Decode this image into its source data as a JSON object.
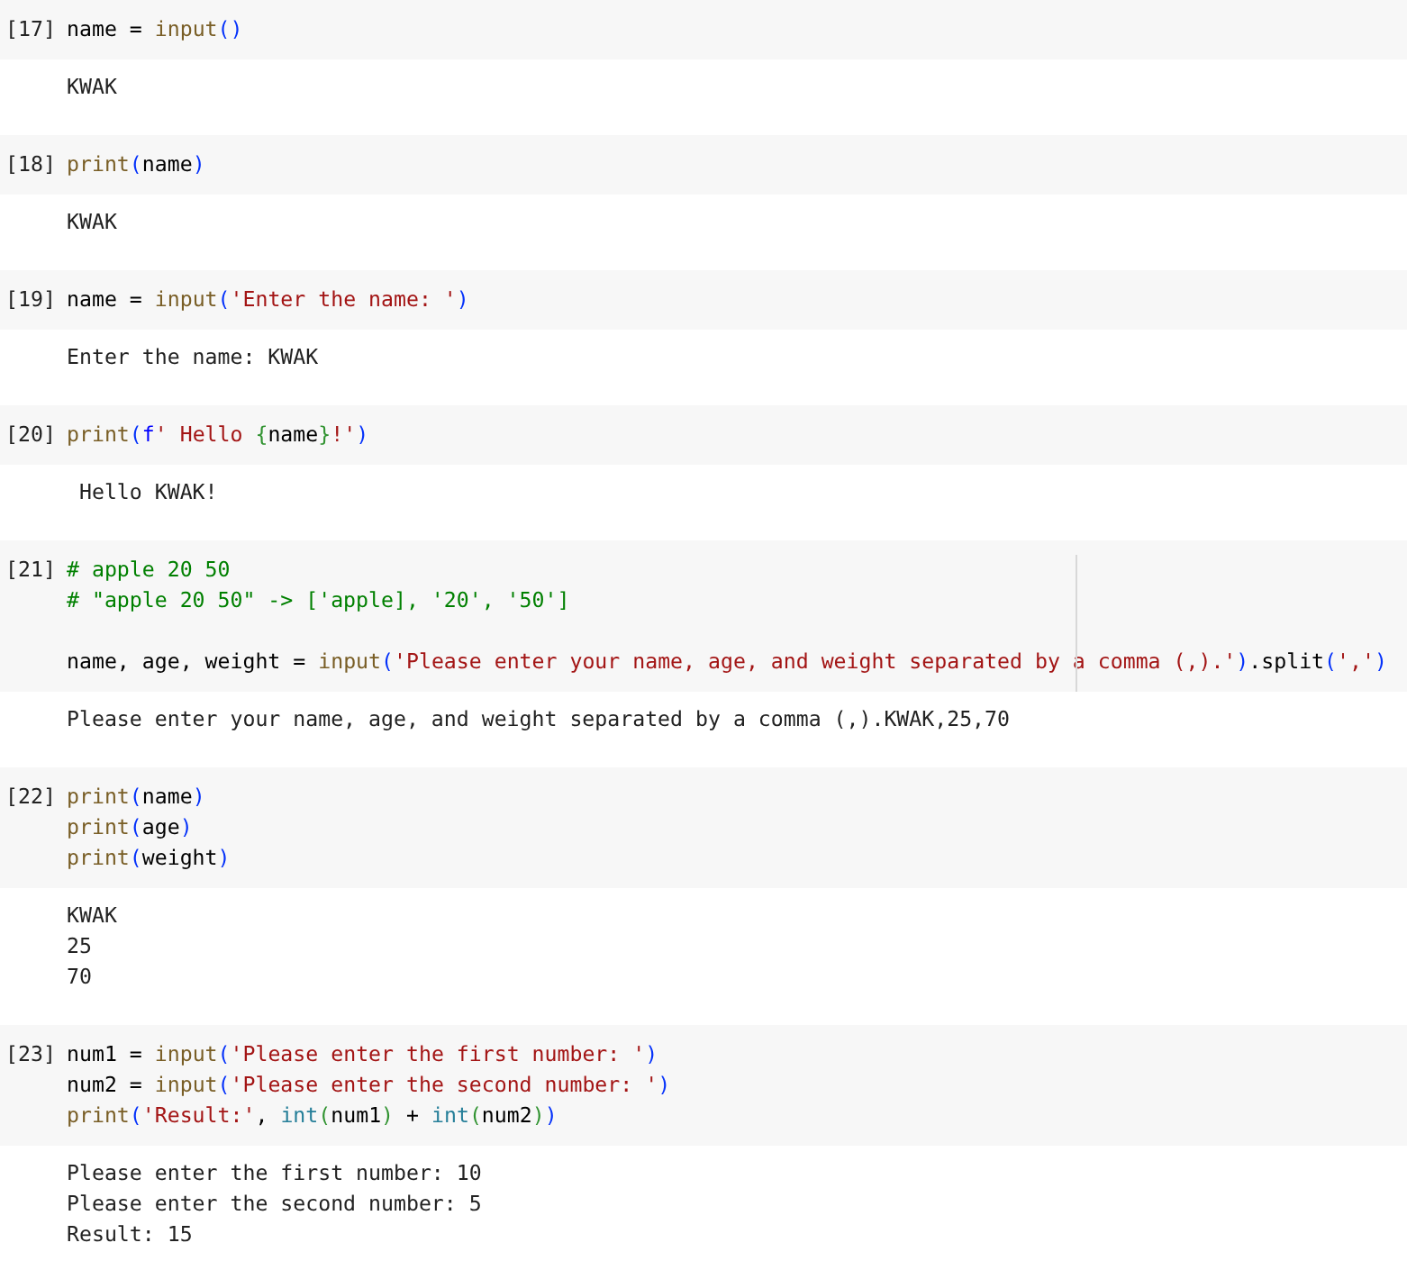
{
  "cells": [
    {
      "prompt": "[17]",
      "code": [
        {
          "tokens": [
            {
              "text": "name = ",
              "color": "#000000"
            },
            {
              "text": "input",
              "color": "#795e26"
            },
            {
              "text": "()",
              "color": "#0431fa"
            }
          ]
        }
      ],
      "output": [
        "KWAK"
      ]
    },
    {
      "prompt": "[18]",
      "code": [
        {
          "tokens": [
            {
              "text": "print",
              "color": "#795e26"
            },
            {
              "text": "(",
              "color": "#0431fa"
            },
            {
              "text": "name",
              "color": "#000000"
            },
            {
              "text": ")",
              "color": "#0431fa"
            }
          ]
        }
      ],
      "output": [
        "KWAK"
      ]
    },
    {
      "prompt": "[19]",
      "code": [
        {
          "tokens": [
            {
              "text": "name = ",
              "color": "#000000"
            },
            {
              "text": "input",
              "color": "#795e26"
            },
            {
              "text": "(",
              "color": "#0431fa"
            },
            {
              "text": "'Enter the name: '",
              "color": "#a31515"
            },
            {
              "text": ")",
              "color": "#0431fa"
            }
          ]
        }
      ],
      "output": [
        "Enter the name: KWAK"
      ]
    },
    {
      "prompt": "[20]",
      "code": [
        {
          "tokens": [
            {
              "text": "print",
              "color": "#795e26"
            },
            {
              "text": "(",
              "color": "#0431fa"
            },
            {
              "text": "f",
              "color": "#0000ff"
            },
            {
              "text": "' Hello ",
              "color": "#a31515"
            },
            {
              "text": "{",
              "color": "#319331"
            },
            {
              "text": "name",
              "color": "#000000"
            },
            {
              "text": "}",
              "color": "#319331"
            },
            {
              "text": "!'",
              "color": "#a31515"
            },
            {
              "text": ")",
              "color": "#0431fa"
            }
          ]
        }
      ],
      "output": [
        " Hello KWAK!"
      ]
    },
    {
      "prompt": "[21]",
      "code": [
        {
          "tokens": [
            {
              "text": "# apple 20 50",
              "color": "#008000"
            }
          ]
        },
        {
          "tokens": [
            {
              "text": "# \"apple 20 50\" -> ['apple], '20', '50']",
              "color": "#008000"
            }
          ]
        },
        {
          "gap_before": true,
          "tokens": [
            {
              "text": "name, age, weight = ",
              "color": "#000000"
            },
            {
              "text": "input",
              "color": "#795e26"
            },
            {
              "text": "(",
              "color": "#0431fa"
            },
            {
              "text": "'Please enter your name, age, and weight separated by a comma (,).'",
              "color": "#a31515"
            },
            {
              "text": ")",
              "color": "#0431fa"
            },
            {
              "text": ".split",
              "color": "#000000"
            },
            {
              "text": "(",
              "color": "#0431fa"
            },
            {
              "text": "','",
              "color": "#a31515"
            },
            {
              "text": ")",
              "color": "#0431fa"
            }
          ]
        }
      ],
      "output": [
        "Please enter your name, age, and weight separated by a comma (,).KWAK,25,70"
      ],
      "ruler": true
    },
    {
      "prompt": "[22]",
      "code": [
        {
          "tokens": [
            {
              "text": "print",
              "color": "#795e26"
            },
            {
              "text": "(",
              "color": "#0431fa"
            },
            {
              "text": "name",
              "color": "#000000"
            },
            {
              "text": ")",
              "color": "#0431fa"
            }
          ]
        },
        {
          "tokens": [
            {
              "text": "print",
              "color": "#795e26"
            },
            {
              "text": "(",
              "color": "#0431fa"
            },
            {
              "text": "age",
              "color": "#000000"
            },
            {
              "text": ")",
              "color": "#0431fa"
            }
          ]
        },
        {
          "tokens": [
            {
              "text": "print",
              "color": "#795e26"
            },
            {
              "text": "(",
              "color": "#0431fa"
            },
            {
              "text": "weight",
              "color": "#000000"
            },
            {
              "text": ")",
              "color": "#0431fa"
            }
          ]
        }
      ],
      "output": [
        "KWAK",
        "25",
        "70"
      ]
    },
    {
      "prompt": "[23]",
      "code": [
        {
          "tokens": [
            {
              "text": "num1 = ",
              "color": "#000000"
            },
            {
              "text": "input",
              "color": "#795e26"
            },
            {
              "text": "(",
              "color": "#0431fa"
            },
            {
              "text": "'Please enter the first number: '",
              "color": "#a31515"
            },
            {
              "text": ")",
              "color": "#0431fa"
            }
          ]
        },
        {
          "tokens": [
            {
              "text": "num2 = ",
              "color": "#000000"
            },
            {
              "text": "input",
              "color": "#795e26"
            },
            {
              "text": "(",
              "color": "#0431fa"
            },
            {
              "text": "'Please enter the second number: '",
              "color": "#a31515"
            },
            {
              "text": ")",
              "color": "#0431fa"
            }
          ]
        },
        {
          "tokens": [
            {
              "text": "print",
              "color": "#795e26"
            },
            {
              "text": "(",
              "color": "#0431fa"
            },
            {
              "text": "'Result:'",
              "color": "#a31515"
            },
            {
              "text": ", ",
              "color": "#000000"
            },
            {
              "text": "int",
              "color": "#267f99"
            },
            {
              "text": "(",
              "color": "#319331"
            },
            {
              "text": "num1",
              "color": "#000000"
            },
            {
              "text": ")",
              "color": "#319331"
            },
            {
              "text": " + ",
              "color": "#000000"
            },
            {
              "text": "int",
              "color": "#267f99"
            },
            {
              "text": "(",
              "color": "#319331"
            },
            {
              "text": "num2",
              "color": "#000000"
            },
            {
              "text": ")",
              "color": "#319331"
            },
            {
              "text": ")",
              "color": "#0431fa"
            }
          ]
        }
      ],
      "output": [
        "Please enter the first number: 10",
        "Please enter the second number: 5",
        "Result: 15"
      ]
    }
  ]
}
